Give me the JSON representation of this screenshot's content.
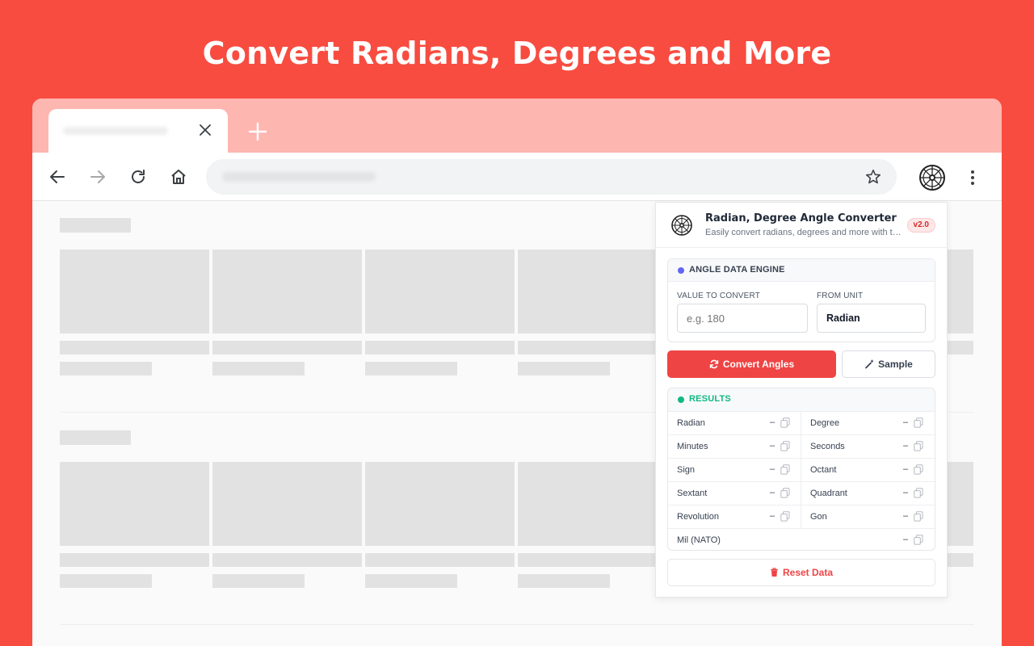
{
  "headline": "Convert Radians, Degrees and More",
  "popup": {
    "title": "Radian, Degree Angle Converter",
    "subtitle": "Easily convert radians, degrees and more with this tool",
    "version": "v2.0",
    "engine": {
      "title": "ANGLE DATA ENGINE",
      "value_label": "VALUE TO CONVERT",
      "value_placeholder": "e.g. 180",
      "value": "",
      "unit_label": "FROM UNIT",
      "unit_value": "Radian"
    },
    "convert_button": "Convert Angles",
    "sample_button": "Sample",
    "results": {
      "title": "RESULTS",
      "items": [
        {
          "label": "Radian",
          "value": "–"
        },
        {
          "label": "Degree",
          "value": "–"
        },
        {
          "label": "Minutes",
          "value": "–"
        },
        {
          "label": "Seconds",
          "value": "–"
        },
        {
          "label": "Sign",
          "value": "–"
        },
        {
          "label": "Octant",
          "value": "–"
        },
        {
          "label": "Sextant",
          "value": "–"
        },
        {
          "label": "Quadrant",
          "value": "–"
        },
        {
          "label": "Revolution",
          "value": "–"
        },
        {
          "label": "Gon",
          "value": "–"
        },
        {
          "label": "Mil (NATO)",
          "value": "–"
        }
      ]
    },
    "reset_button": "Reset Data"
  },
  "colors": {
    "background": "#f84c40",
    "tabstrip": "#feb6b1",
    "accent": "#ef4444",
    "engine_dot": "#6366f1",
    "results_dot": "#10b981",
    "results_title": "#10b981"
  },
  "icons": [
    "close-icon",
    "plus-icon",
    "back-icon",
    "forward-icon",
    "reload-icon",
    "home-icon",
    "star-icon",
    "compass-icon",
    "kebab-menu-icon",
    "refresh-icon",
    "magic-wand-icon",
    "copy-icon",
    "trash-icon"
  ]
}
